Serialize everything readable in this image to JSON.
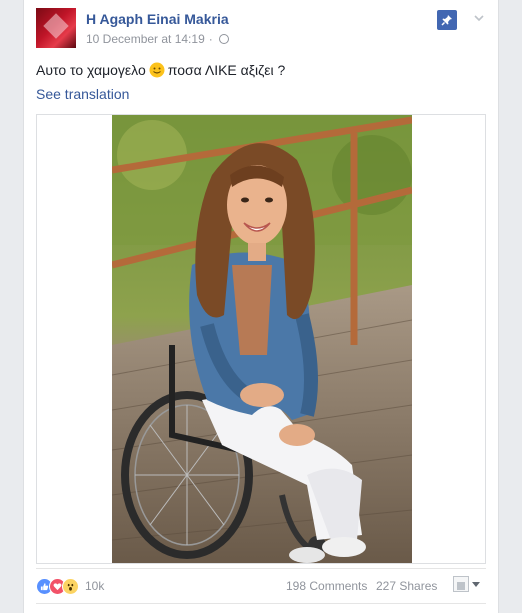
{
  "post": {
    "page_name": "H Agaph Einai Makria",
    "timestamp": "10 December at 14:19",
    "separator": "·",
    "text_before": "Αυτο το χαμογελο",
    "text_after": "ποσα ΛΙΚΕ αξιζει ?",
    "see_translation": "See translation",
    "emoji": "slightly-smiling-face"
  },
  "footer": {
    "reactions": [
      "like-icon",
      "love-icon",
      "wow-icon"
    ],
    "reaction_count": "10k",
    "comments": "198 Comments",
    "shares": "227 Shares"
  },
  "colors": {
    "link": "#365899",
    "accent": "#4267b2",
    "muted": "#90949c",
    "background": "#e9ebee"
  }
}
